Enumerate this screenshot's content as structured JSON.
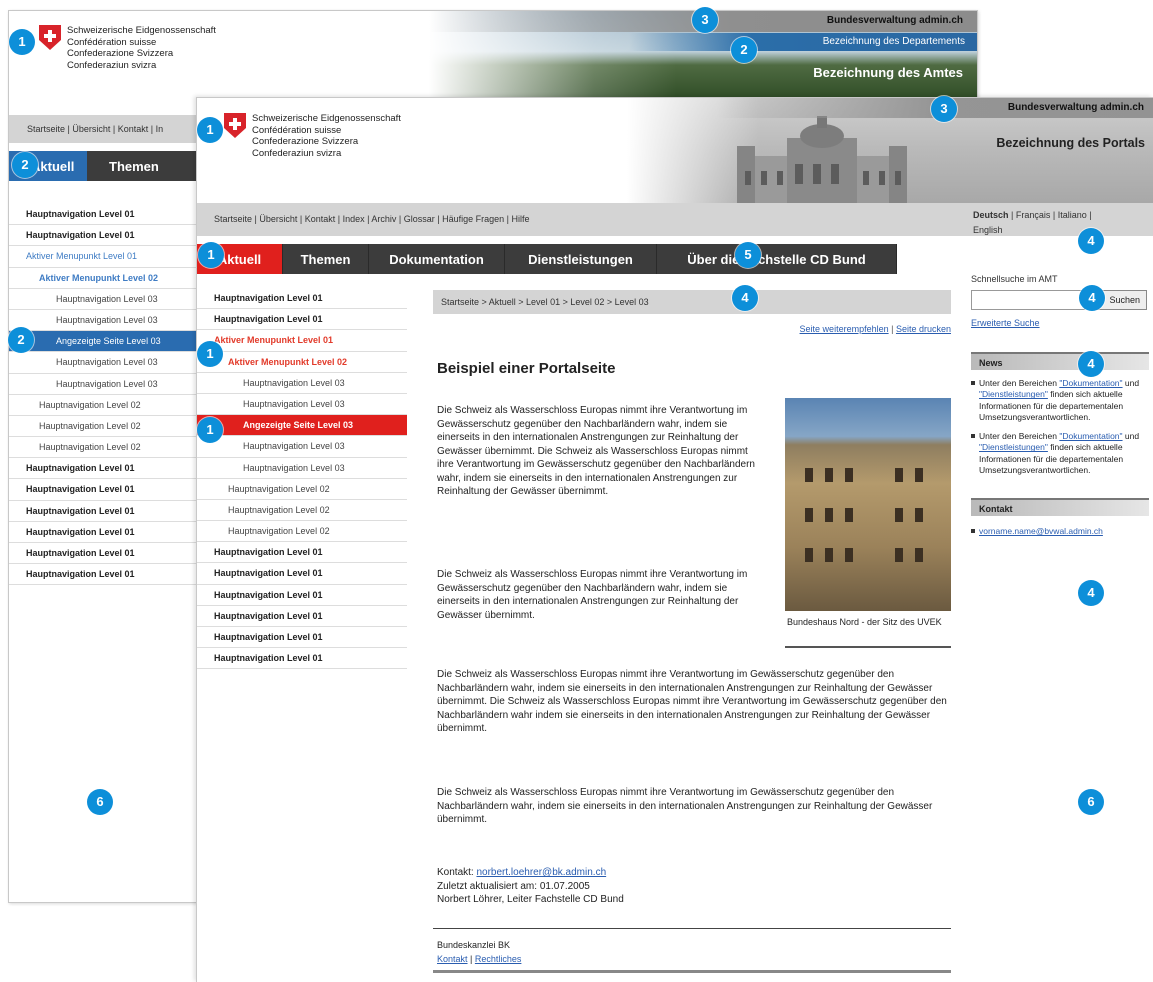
{
  "confederation": [
    "Schweizerische Eidgenossenschaft",
    "Confédération suisse",
    "Confederazione Svizzera",
    "Confederaziun svizra"
  ],
  "back": {
    "top_bar": "Bundesverwaltung admin.ch",
    "department": "Bezeichnung des Departements",
    "office": "Bezeichnung des Amtes",
    "service_links": "Startseite | Übersicht | Kontakt | In",
    "tabs": [
      "Aktuell",
      "Themen"
    ],
    "nav": [
      {
        "label": "Hauptnavigation Level 01",
        "kind": "l1"
      },
      {
        "label": "Hauptnavigation Level 01",
        "kind": "l1"
      },
      {
        "label": "Aktiver Menupunkt Level 01",
        "kind": "act1"
      },
      {
        "label": "Aktiver Menupunkt Level 02",
        "kind": "act2"
      },
      {
        "label": "Hauptnavigation Level 03",
        "kind": "l3"
      },
      {
        "label": "Hauptnavigation Level 03",
        "kind": "l3"
      },
      {
        "label": "Angezeigte Seite Level 03",
        "kind": "sel"
      },
      {
        "label": "Hauptnavigation Level 03",
        "kind": "l3"
      },
      {
        "label": "Hauptnavigation Level 03",
        "kind": "l3"
      },
      {
        "label": "Hauptnavigation Level 02",
        "kind": "l2"
      },
      {
        "label": "Hauptnavigation Level 02",
        "kind": "l2"
      },
      {
        "label": "Hauptnavigation Level 02",
        "kind": "l2"
      },
      {
        "label": "Hauptnavigation Level 01",
        "kind": "l1"
      },
      {
        "label": "Hauptnavigation Level 01",
        "kind": "l1"
      },
      {
        "label": "Hauptnavigation Level 01",
        "kind": "l1"
      },
      {
        "label": "Hauptnavigation Level 01",
        "kind": "l1"
      },
      {
        "label": "Hauptnavigation Level 01",
        "kind": "l1"
      },
      {
        "label": "Hauptnavigation Level 01",
        "kind": "l1"
      }
    ]
  },
  "front": {
    "top_bar": "Bundesverwaltung admin.ch",
    "portal": "Bezeichnung des Portals",
    "service_links": "Startseite | Übersicht | Kontakt | Index | Archiv | Glossar | Häufige Fragen | Hilfe",
    "languages": {
      "active": "Deutsch",
      "rest": " | Français | Italiano |",
      "line2": "English"
    },
    "tabs": [
      "Aktuell",
      "Themen",
      "Dokumentation",
      "Dienstleistungen",
      "Über die Fachstelle CD Bund"
    ],
    "nav": [
      {
        "label": "Hauptnavigation Level 01",
        "kind": "l1"
      },
      {
        "label": "Hauptnavigation Level 01",
        "kind": "l1"
      },
      {
        "label": "Aktiver Menupunkt Level 01",
        "kind": "act1"
      },
      {
        "label": "Aktiver Menupunkt Level 02",
        "kind": "act2"
      },
      {
        "label": "Hauptnavigation Level 03",
        "kind": "l3"
      },
      {
        "label": "Hauptnavigation Level 03",
        "kind": "l3"
      },
      {
        "label": "Angezeigte Seite Level 03",
        "kind": "sel"
      },
      {
        "label": "Hauptnavigation Level 03",
        "kind": "l3"
      },
      {
        "label": "Hauptnavigation Level 03",
        "kind": "l3"
      },
      {
        "label": "Hauptnavigation Level 02",
        "kind": "l2"
      },
      {
        "label": "Hauptnavigation Level 02",
        "kind": "l2"
      },
      {
        "label": "Hauptnavigation Level 02",
        "kind": "l2"
      },
      {
        "label": "Hauptnavigation Level 01",
        "kind": "l1"
      },
      {
        "label": "Hauptnavigation Level 01",
        "kind": "l1"
      },
      {
        "label": "Hauptnavigation Level 01",
        "kind": "l1"
      },
      {
        "label": "Hauptnavigation Level 01",
        "kind": "l1"
      },
      {
        "label": "Hauptnavigation Level 01",
        "kind": "l1"
      },
      {
        "label": "Hauptnavigation Level 01",
        "kind": "l1"
      }
    ],
    "breadcrumb": "Startseite > Aktuell > Level 01 > Level 02 > Level 03",
    "page_links": [
      "Seite weiterempfehlen",
      "Seite drucken"
    ],
    "title": "Beispiel einer Portalseite",
    "paragraphs": {
      "p1": "Die Schweiz als Wasserschloss Europas nimmt ihre Verantwortung im Gewässerschutz gegenüber den Nachbarländern wahr, indem sie einerseits in den internationalen Anstrengungen zur Reinhaltung der Gewässer übernimmt. Die Schweiz als Wasserschloss Europas nimmt ihre Verantwortung im Gewässerschutz gegenüber den Nachbarländern wahr, indem sie einerseits in den internationalen Anstrengungen zur Reinhaltung der Gewässer übernimmt.",
      "p2": "Die Schweiz als Wasserschloss Europas nimmt ihre Verantwortung im Gewässerschutz gegenüber den Nachbarländern wahr, indem sie einerseits in den internationalen Anstrengungen zur Reinhaltung der Gewässer übernimmt.",
      "p3": "Die Schweiz als Wasserschloss Europas nimmt ihre Verantwortung im Gewässerschutz gegenüber den Nachbarländern wahr, indem sie einerseits in den internationalen Anstrengungen zur Reinhaltung der Gewässer übernimmt. Die Schweiz als Wasserschloss Europas nimmt ihre Verantwortung im Gewässerschutz gegenüber den Nachbarländern wahr indem sie einerseits in den internationalen Anstrengungen zur Reinhaltung der Gewässer übernimmt.",
      "p4": "Die Schweiz als Wasserschloss Europas nimmt ihre Verantwortung im Gewässerschutz gegenüber den Nachbarländern wahr, indem sie einerseits in den internationalen Anstrengungen zur Reinhaltung der Gewässer übernimmt."
    },
    "caption": "Bundeshaus Nord - der Sitz des UVEK",
    "contact": {
      "label": "Kontakt: ",
      "email": "norbert.loehrer@bk.admin.ch",
      "updated": "Zuletzt aktualisiert am: 01.07.2005",
      "person": "Norbert Löhrer, Leiter Fachstelle CD Bund"
    },
    "footer": {
      "org": "Bundeskanzlei BK",
      "links": [
        "Kontakt",
        "Rechtliches"
      ]
    },
    "sidebar": {
      "search_label": "Schnellsuche im AMT",
      "search_button": "Suchen",
      "advanced": "Erweiterte Suche",
      "news_title": "News",
      "news_items": [
        {
          "pre": "Unter den Bereichen ",
          "link1": "\"Dokumentation\"",
          "mid": " und ",
          "link2": "\"Dienstleistungen\"",
          "post": " finden sich aktuelle Informationen für die departementalen Umsetzungsverantwortlichen."
        },
        {
          "pre": "Unter den Bereichen ",
          "link1": "\"Dokumentation\"",
          "mid": " und ",
          "link2": "\"Dienstleistungen\"",
          "post": " finden sich aktuelle Informationen für die departementalen Umsetzungsverantwortlichen."
        }
      ],
      "contact_title": "Kontakt",
      "contact_email": "vorname.name@bvwal.admin.ch"
    }
  },
  "markers": [
    "1",
    "2",
    "3",
    "2",
    "1",
    "3",
    "2",
    "1",
    "5",
    "4",
    "4",
    "4",
    "4",
    "1",
    "2",
    "1",
    "4",
    "6",
    "6"
  ],
  "colors": {
    "accent_blue": "#0d8fd9",
    "swiss_red": "#e0201d",
    "back_tab_blue": "#2a6cb0"
  }
}
